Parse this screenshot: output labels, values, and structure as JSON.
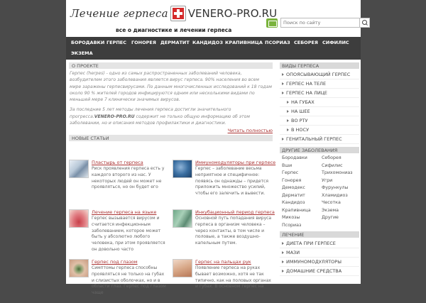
{
  "header": {
    "logo_left": "Лечение герпеса",
    "logo_right": "VENERO-PRO.RU",
    "tagline": "все о диагностике и лечении герпеса",
    "search_placeholder": "Поиск по сайту",
    "accent_color": "#d42a2a"
  },
  "nav": {
    "items": [
      "БОРОДАВКИ",
      "ГЕРПЕС",
      "ГОНОРЕЯ",
      "ДЕРМАТИТ",
      "КАНДИДОЗ",
      "КРАПИВНИЦА",
      "ПСОРИАЗ",
      "СЕБОРЕЯ",
      "СИФИЛИС",
      "ЭКЗЕМА"
    ]
  },
  "about": {
    "heading": "О ПРОЕКТЕ",
    "p1": "Герпес (herpes) - одно из самых распространенных заболеваний человека, возбудителем этого заболевания является вирус герпеса. 90% населения во всем мире заражены герпесвирусами. По данным многочисленных исследований к 18 годам около 90 % жителей городов инфицируются одним или несколькими видами по меньшей мере 7 клинически значимых вирусов.",
    "p2_start": "За последние 5 лет методы лечения герпеса достигли значительного прогресса.",
    "p2_bold": "VENERO-PRO.RU",
    "p2_end": " содержит не только общую информацию об этом заболевании, но и описания методов профилактики и диагностики.",
    "read_full": "Читать полностью"
  },
  "new_articles": {
    "heading": "НОВЫЕ СТАТЬИ",
    "items": [
      {
        "title": "Пластырь от герпеса",
        "text": "Риск проявления герпеса есть у каждого второго из нас. У некоторых людей он может не проявляться, но он будет его"
      },
      {
        "title": "Иммуномодуляторы при герпесе",
        "text": "Герпес – заболевание весьма неприятное и специфичное: появясь он однажды – придется приложить множество усилий, чтобы его залечить и вывести."
      },
      {
        "title": "Лечение герпеса на языке",
        "text": "Герпес вызывается вирусом и считается инфекционным заболеванием, которое может быть у абсолютно любого человека, при этом проявляется он довольно часто"
      },
      {
        "title": "Инкубационный период герпеса",
        "text": "Основной путь попадания вируса герпеса в организм человека – через контакты, в том числе и половые, а также воздушно-капельным путем."
      },
      {
        "title": "Герпес под глазом",
        "text": "Симптомы герпеса способны проявляться не только на губах и слизистых оболочках, но и в области глаз. Герпес под глазом чаще"
      },
      {
        "title": "Герпес на пальцах рук",
        "text": "Появление герпеса на руках бывает возможно, хотя не так типично, как на половых органах и губах. В основном герпес на"
      }
    ]
  },
  "sidebar": {
    "types_heading": "ВИДЫ ГЕРПЕСА",
    "types": [
      {
        "label": "ОПОЯСЫВАЮЩИЙ ГЕРПЕС",
        "sub": false
      },
      {
        "label": "ГЕРПЕС НА ТЕЛЕ",
        "sub": false
      },
      {
        "label": "ГЕРПЕС НА ЛИЦЕ",
        "sub": false
      },
      {
        "label": "НА ГУБАХ",
        "sub": true
      },
      {
        "label": "НА ШЕЕ",
        "sub": true
      },
      {
        "label": "ВО РТУ",
        "sub": true
      },
      {
        "label": "В НОСУ",
        "sub": true
      },
      {
        "label": "ГЕНИТАЛЬНЫЙ ГЕРПЕС",
        "sub": false
      }
    ],
    "other_heading": "ДРУГИЕ ЗАБОЛЕВАНИЯ",
    "other": [
      "Бородавки",
      "Себорея",
      "Вши",
      "Сифилис",
      "Герпес",
      "Трихомониаз",
      "Гонорея",
      "Угри",
      "Демодекс",
      "Фурункулы",
      "Дерматит",
      "Хламидиоз",
      "Кандидоз",
      "Чесотка",
      "Крапивница",
      "Экзема",
      "Микозы",
      "Другие",
      "Псориаз"
    ],
    "treatment_heading": "ЛЕЧЕНИЕ",
    "treatment": [
      "ДИЕТА ПРИ ГЕРПЕСЕ",
      "МАЗИ",
      "ИММУНОМОДУЛЯТОРЫ",
      "ДОМАШНИЕ СРЕДСТВА"
    ]
  }
}
